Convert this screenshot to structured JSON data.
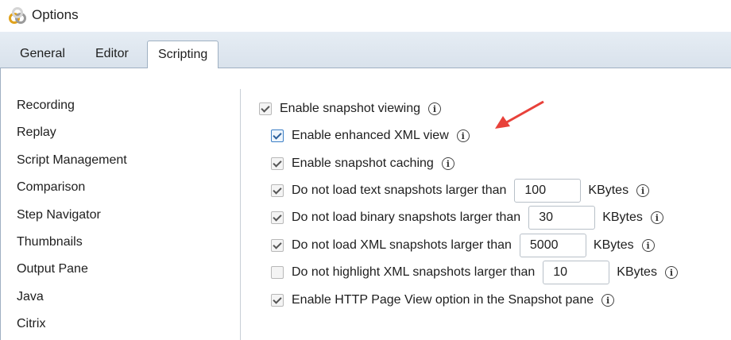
{
  "window": {
    "title": "Options",
    "icon": "chain-link-icon"
  },
  "tabs": [
    {
      "label": "General",
      "active": false
    },
    {
      "label": "Editor",
      "active": false
    },
    {
      "label": "Scripting",
      "active": true
    }
  ],
  "sidebar": {
    "items": [
      {
        "label": "Recording"
      },
      {
        "label": "Replay"
      },
      {
        "label": "Script Management"
      },
      {
        "label": "Comparison"
      },
      {
        "label": "Step Navigator"
      },
      {
        "label": "Thumbnails"
      },
      {
        "label": "Output Pane"
      },
      {
        "label": "Java"
      },
      {
        "label": "Citrix"
      }
    ]
  },
  "settings": {
    "enable_snapshot_viewing": {
      "label": "Enable snapshot viewing",
      "checked": true
    },
    "enable_enhanced_xml_view": {
      "label": "Enable enhanced XML view",
      "checked": true
    },
    "enable_snapshot_caching": {
      "label": "Enable snapshot caching",
      "checked": true
    },
    "text_limit": {
      "label": "Do not load text snapshots larger than",
      "checked": true,
      "value": "100",
      "unit": "KBytes"
    },
    "binary_limit": {
      "label": "Do not load binary snapshots larger than",
      "checked": true,
      "value": "30",
      "unit": "KBytes"
    },
    "xml_limit": {
      "label": "Do not load XML snapshots larger than",
      "checked": true,
      "value": "5000",
      "unit": "KBytes"
    },
    "highlight_limit": {
      "label": "Do not highlight XML snapshots larger than",
      "checked": false,
      "value": "10",
      "unit": "KBytes"
    },
    "http_page_view": {
      "label": "Enable HTTP Page View option in the Snapshot pane",
      "checked": true
    }
  },
  "colors": {
    "annotation_arrow": "#e8413a",
    "focus_border": "#3c7fc6"
  }
}
